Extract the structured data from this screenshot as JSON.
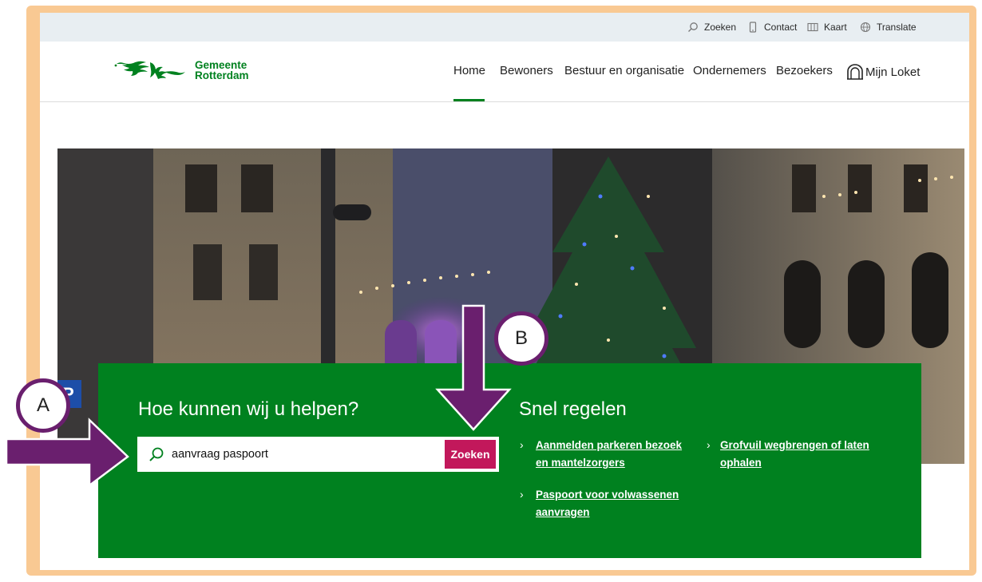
{
  "utility_bar": {
    "items": [
      {
        "label": "Zoeken",
        "icon": "search-icon"
      },
      {
        "label": "Contact",
        "icon": "phone-icon"
      },
      {
        "label": "Kaart",
        "icon": "map-icon"
      },
      {
        "label": "Translate",
        "icon": "globe-icon"
      }
    ]
  },
  "header": {
    "logo_line1": "Gemeente",
    "logo_line2": "Rotterdam",
    "nav": [
      "Home",
      "Bewoners",
      "Bestuur en organisatie",
      "Ondernemers",
      "Bezoekers",
      "Mijn Loket"
    ],
    "active_nav": "Home"
  },
  "search_panel": {
    "title": "Hoe kunnen wij u helpen?",
    "input_value": "aanvraag paspoort",
    "button_label": "Zoeken"
  },
  "snel_regelen": {
    "title": "Snel regelen",
    "links": [
      {
        "line1": "Aanmelden parkeren bezoek",
        "line2": "en mantelzorgers"
      },
      {
        "line1": "Paspoort voor volwassenen",
        "line2": "aanvragen"
      },
      {
        "line1": "Grofvuil wegbrengen of laten",
        "line2": "ophalen"
      }
    ]
  },
  "annotations": {
    "badge_a": "A",
    "badge_b": "B"
  },
  "colors": {
    "brand_green": "#00811f",
    "button_magenta": "#c2185b",
    "annotation_purple": "#6a1f6e",
    "frame_orange": "#f9c993"
  }
}
